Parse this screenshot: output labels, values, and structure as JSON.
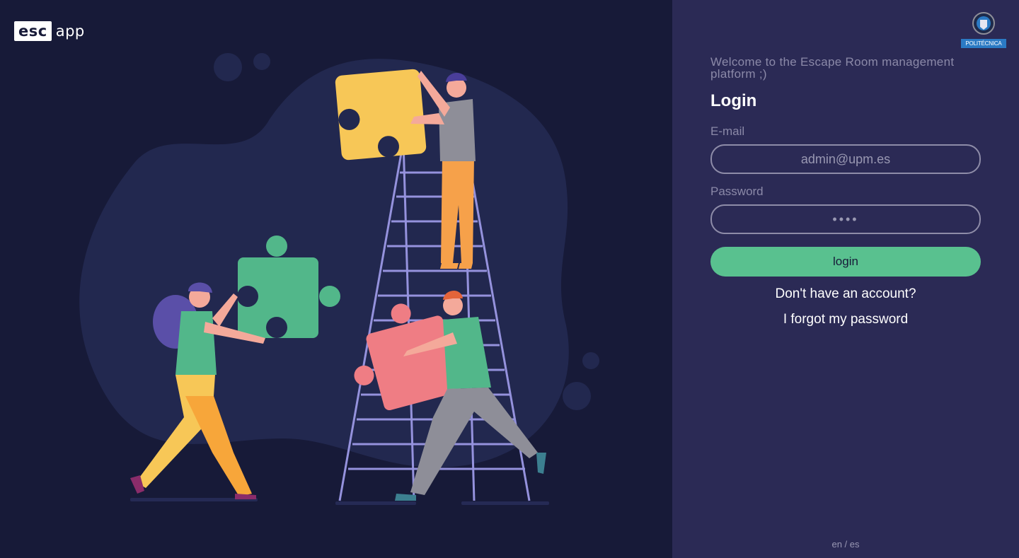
{
  "logo": {
    "box_text": "esc",
    "app_text": "app"
  },
  "institution": {
    "badge_text": "POLITÉCNICA"
  },
  "login": {
    "welcome": "Welcome to the Escape Room management platform ;)",
    "heading": "Login",
    "email_label": "E-mail",
    "email_placeholder": "admin@upm.es",
    "password_label": "Password",
    "password_placeholder": "••••",
    "submit_label": "login",
    "signup_link": "Don't have an account?",
    "forgot_link": "I forgot my password"
  },
  "language": {
    "en": "en",
    "separator": " / ",
    "es": "es"
  },
  "colors": {
    "left_background": "#171a38",
    "right_background": "#2b2a55",
    "blob": "#22284f",
    "accent_green": "#59c18f",
    "puzzle_yellow": "#f7c757",
    "puzzle_green": "#52b78a",
    "puzzle_pink": "#ef7d84",
    "ladder": "#9592dd"
  }
}
